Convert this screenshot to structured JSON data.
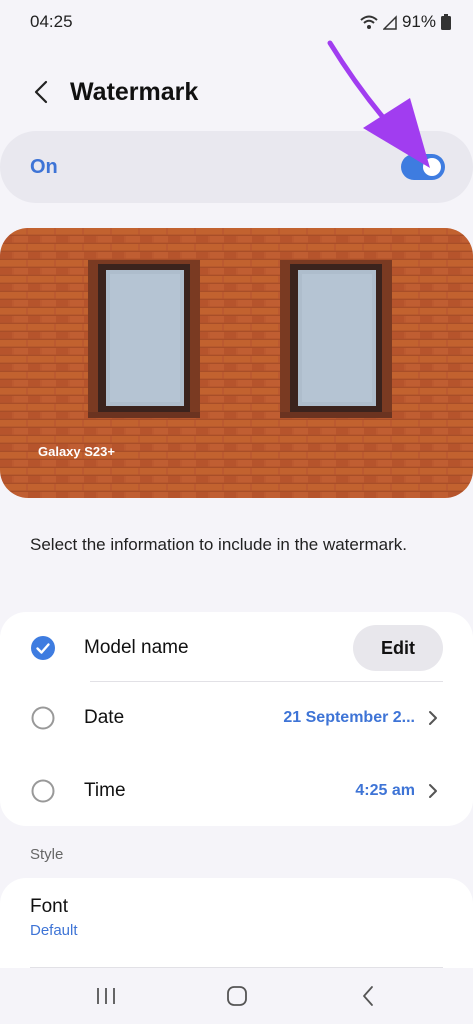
{
  "status_bar": {
    "time": "04:25",
    "battery_percent": "91%"
  },
  "header": {
    "title": "Watermark"
  },
  "master_toggle": {
    "label": "On",
    "checked": true
  },
  "preview": {
    "watermark_text": "Galaxy S23+"
  },
  "instructions": "Select the information to include in the watermark.",
  "options": [
    {
      "label": "Model name",
      "checked": true,
      "action_label": "Edit"
    },
    {
      "label": "Date",
      "checked": false,
      "value": "21 September 2..."
    },
    {
      "label": "Time",
      "checked": false,
      "value": "4:25 am"
    }
  ],
  "style_section": {
    "header": "Style",
    "font": {
      "title": "Font",
      "value": "Default"
    }
  },
  "nav": {
    "recents": "recents-icon",
    "home": "home-icon",
    "back": "back-icon"
  },
  "colors": {
    "accent": "#3e74d6",
    "annotation_arrow": "#a13df0",
    "brick": "#b8562f"
  }
}
